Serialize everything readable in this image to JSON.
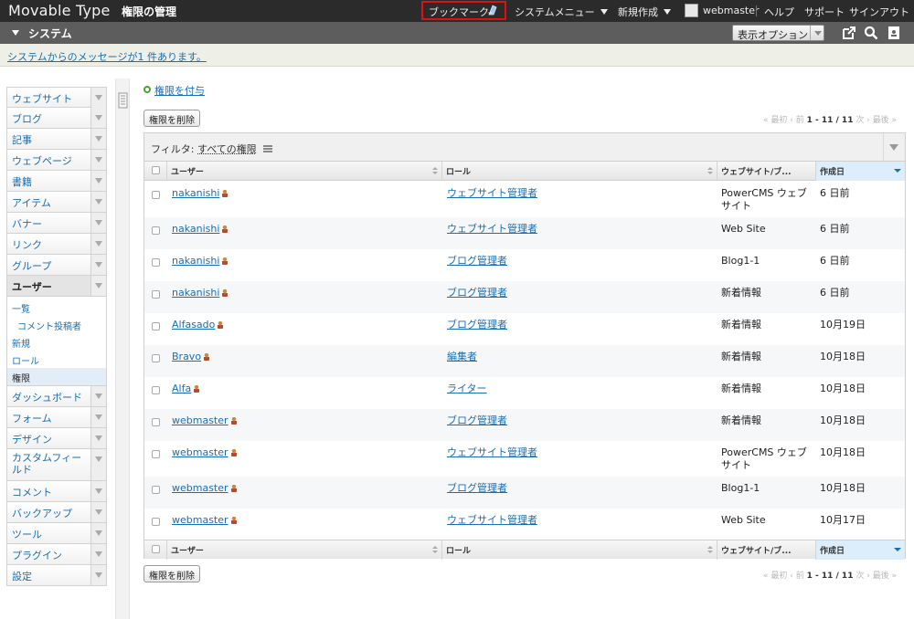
{
  "app": {
    "name": "Movable Type",
    "page_title": "権限の管理"
  },
  "topnav": {
    "bookmark": "ブックマーク",
    "system_menu": "システムメニュー",
    "new": "新規作成",
    "user": "webmaster",
    "help": "ヘルプ",
    "support": "サポート",
    "signout": "サインアウト"
  },
  "scope": {
    "name": "システム",
    "display_options": "表示オプション"
  },
  "message": "システムからのメッセージが1 件あります。",
  "sidebar": {
    "items": [
      {
        "label": "ウェブサイト"
      },
      {
        "label": "ブログ"
      },
      {
        "label": "記事"
      },
      {
        "label": "ウェブページ"
      },
      {
        "label": "書籍"
      },
      {
        "label": "アイテム"
      },
      {
        "label": "バナー"
      },
      {
        "label": "リンク"
      },
      {
        "label": "グループ"
      },
      {
        "label": "ユーザー"
      }
    ],
    "user_submenu": [
      {
        "label": "一覧"
      },
      {
        "label": "コメント投稿者"
      },
      {
        "label": "新規"
      },
      {
        "label": "ロール"
      },
      {
        "label": "権限"
      }
    ],
    "items_after": [
      {
        "label": "ダッシュボード"
      },
      {
        "label": "フォーム"
      },
      {
        "label": "デザイン"
      },
      {
        "label": "カスタムフィールド"
      },
      {
        "label": "コメント"
      },
      {
        "label": "バックアップ"
      },
      {
        "label": "ツール"
      },
      {
        "label": "プラグイン"
      },
      {
        "label": "設定"
      }
    ]
  },
  "actions": {
    "grant": "権限を付与",
    "delete": "権限を削除"
  },
  "pager": {
    "first": "« 最初",
    "prev": "‹ 前",
    "range": "1 - 11 / 11",
    "next": "次 ›",
    "last": "最後 »"
  },
  "filter": {
    "label": "フィルタ:",
    "value": "すべての権限"
  },
  "table": {
    "headers": {
      "user": "ユーザー",
      "role": "ロール",
      "site": "ウェブサイト/ブ...",
      "created": "作成日"
    },
    "rows": [
      {
        "user": "nakanishi",
        "role": "ウェブサイト管理者",
        "site": "PowerCMS ウェブサイト",
        "date": "6 日前"
      },
      {
        "user": "nakanishi",
        "role": "ウェブサイト管理者",
        "site": "Web Site",
        "date": "6 日前"
      },
      {
        "user": "nakanishi",
        "role": "ブログ管理者",
        "site": "Blog1-1",
        "date": "6 日前"
      },
      {
        "user": "nakanishi",
        "role": "ブログ管理者",
        "site": "新着情報",
        "date": "6 日前"
      },
      {
        "user": "Alfasado",
        "role": "ブログ管理者",
        "site": "新着情報",
        "date": "10月19日"
      },
      {
        "user": "Bravo",
        "role": "編集者",
        "site": "新着情報",
        "date": "10月18日"
      },
      {
        "user": "Alfa",
        "role": "ライター",
        "site": "新着情報",
        "date": "10月18日"
      },
      {
        "user": "webmaster",
        "role": "ブログ管理者",
        "site": "新着情報",
        "date": "10月18日"
      },
      {
        "user": "webmaster",
        "role": "ウェブサイト管理者",
        "site": "PowerCMS ウェブサイト",
        "date": "10月18日"
      },
      {
        "user": "webmaster",
        "role": "ブログ管理者",
        "site": "Blog1-1",
        "date": "10月18日"
      },
      {
        "user": "webmaster",
        "role": "ウェブサイト管理者",
        "site": "Web Site",
        "date": "10月17日"
      }
    ]
  },
  "colors": {
    "topbar": "#2b2b2b",
    "scopebar": "#5d5d5d",
    "link": "#1a6eb3",
    "highlight": "#e01010"
  }
}
